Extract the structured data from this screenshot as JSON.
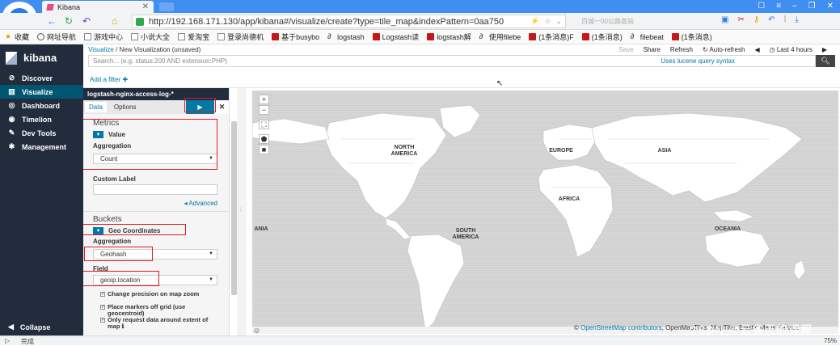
{
  "browser": {
    "tab_title": "Kibana",
    "url": "http://192.168.171.130/app/kibana#/visualize/create?type=tile_map&indexPattern=0aa750",
    "search_placeholder": "百城一00公路南站",
    "status_text": "完成",
    "zoom": "75%",
    "bookmarks": [
      {
        "label": "收藏",
        "icon": "star-icon"
      },
      {
        "label": "网址导航",
        "icon": "globe-icon"
      },
      {
        "label": "游戏中心",
        "icon": "page-icon"
      },
      {
        "label": "小说大全",
        "icon": "page-icon"
      },
      {
        "label": "爱淘宝",
        "icon": "page-icon"
      },
      {
        "label": "登录尚德机",
        "icon": "page-icon"
      },
      {
        "label": "基于busybo",
        "icon": "csdn-icon"
      },
      {
        "label": "logstash",
        "icon": "a-icon"
      },
      {
        "label": "Logstash读",
        "icon": "csdn-icon"
      },
      {
        "label": "logstash解",
        "icon": "csdn-icon"
      },
      {
        "label": "使用filebe",
        "icon": "a-icon"
      },
      {
        "label": "(1条消息)F",
        "icon": "csdn-icon"
      },
      {
        "label": "(1条消息)",
        "icon": "csdn-icon"
      },
      {
        "label": "filebeat",
        "icon": "a-icon"
      },
      {
        "label": "(1条消息)",
        "icon": "csdn-icon"
      }
    ]
  },
  "kibana": {
    "brand": "kibana",
    "nav": [
      {
        "label": "Discover",
        "icon": "compass-icon",
        "glyph": "⊘"
      },
      {
        "label": "Visualize",
        "icon": "bar-chart-icon",
        "glyph": "▥",
        "active": true
      },
      {
        "label": "Dashboard",
        "icon": "dashboard-icon",
        "glyph": "◎"
      },
      {
        "label": "Timelion",
        "icon": "timelion-icon",
        "glyph": "◉"
      },
      {
        "label": "Dev Tools",
        "icon": "wrench-icon",
        "glyph": "✎"
      },
      {
        "label": "Management",
        "icon": "gear-icon",
        "glyph": "✱"
      }
    ],
    "collapse_label": "Collapse",
    "breadcrumb": {
      "root": "Visualize",
      "sep": " / ",
      "current": "New Visualization (unsaved)"
    },
    "top_menu": {
      "save": "Save",
      "share": "Share",
      "refresh": "Refresh",
      "auto_refresh": "Auto-refresh",
      "time": "Last 4 hours"
    },
    "query_placeholder": "Search... (e.g. status:200 AND extension:PHP)",
    "lucene_link": "Uses lucene query syntax",
    "add_filter": "Add a filter ✚"
  },
  "editor": {
    "index_pattern": "logstash-nginx-access-log-*",
    "tabs": [
      "Data",
      "Options"
    ],
    "metrics_title": "Metrics",
    "metric_name": "Value",
    "aggregation_label": "Aggregation",
    "metric_aggregation": "Count",
    "custom_label": "Custom Label",
    "advanced": "◂ Advanced",
    "buckets_title": "Buckets",
    "bucket_name": "Geo Coordinates",
    "bucket_aggregation": "Geohash",
    "field_label": "Field",
    "field_value": "geoip.location",
    "checkboxes": [
      "Change precision on map zoom",
      "Place markers off grid (use geocentroid)",
      "Only request data around extent of map ℹ"
    ]
  },
  "map": {
    "labels": {
      "north_america": "NORTH AMERICA",
      "europe": "EUROPE",
      "asia": "ASIA",
      "africa": "AFRICA",
      "south_america": "SOUTH AMERICA",
      "oceania_left": "ANIA",
      "oceania": "OCEANIA"
    },
    "attribution_prefix": "© ",
    "attribution_link": "OpenStreetMap contributors",
    "attribution_rest": ", OpenMapTiles, MapTiler, Elastic Maps Service"
  },
  "watermark": "CSDN @云雀天的课程"
}
